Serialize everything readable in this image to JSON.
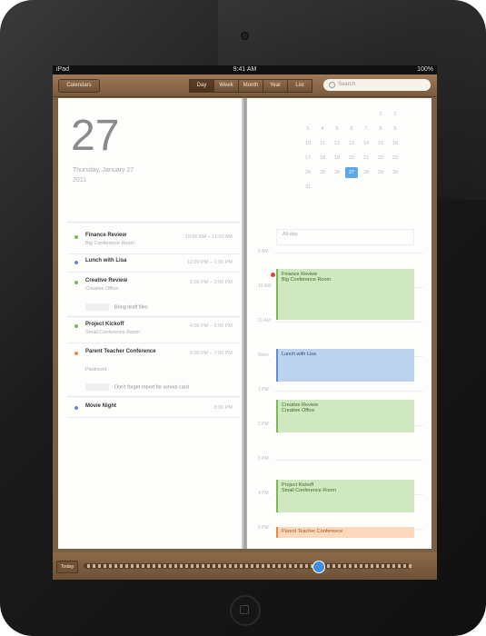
{
  "status": {
    "left": "iPad",
    "time": "9:41 AM",
    "right": "100%"
  },
  "nav": {
    "back_label": "Calendars",
    "segments": [
      {
        "label": "Day",
        "active": true
      },
      {
        "label": "Week",
        "active": false
      },
      {
        "label": "Month",
        "active": false
      },
      {
        "label": "Year",
        "active": false
      },
      {
        "label": "List",
        "active": false
      }
    ],
    "search_placeholder": "Search"
  },
  "day": {
    "number": "27",
    "full_date": "Thursday, January 27",
    "year": "2011"
  },
  "events": [
    {
      "title": "Finance Review",
      "sub": "Big Conference Room",
      "time": "10:00 AM – 11:00 AM",
      "color": "#7ab85a"
    },
    {
      "title": "Lunch with Lisa",
      "sub": "",
      "time": "12:00 PM – 1:00 PM",
      "color": "#5a8fd8"
    },
    {
      "title": "Creative Review",
      "sub": "Creative Office",
      "time": "2:00 PM – 3:00 PM",
      "color": "#7ab85a"
    },
    {
      "title": "Project Kickoff",
      "sub": "Small Conference Room",
      "time": "4:00 PM – 5:00 PM",
      "color": "#7ab85a"
    },
    {
      "title": "Parent Teacher Conference",
      "sub": "Piedmont",
      "time": "6:00 PM – 7:00 PM",
      "color": "#f08a3a"
    },
    {
      "title": "Movie Night",
      "sub": "",
      "time": "8:00 PM",
      "color": "#5a8fd8"
    }
  ],
  "notes": [
    {
      "text": "Bring draft files"
    },
    {
      "text": "Don't forget report for school card"
    }
  ],
  "timeline": {
    "hours": [
      "9 AM",
      "10 AM",
      "11 AM",
      "Noon",
      "1 PM",
      "2 PM",
      "3 PM",
      "4 PM",
      "5 PM"
    ],
    "allday": "All-day",
    "blocks": [
      {
        "title": "Finance Review",
        "sub": "Big Conference Room",
        "style": "green"
      },
      {
        "title": "Lunch with Lisa",
        "sub": "",
        "style": "blue"
      },
      {
        "title": "Creative Review",
        "sub": "Creative Office",
        "style": "green"
      },
      {
        "title": "Project Kickoff",
        "sub": "Small Conference Room",
        "style": "green"
      },
      {
        "title": "Parent Teacher Conference",
        "sub": "",
        "style": "orange"
      }
    ]
  },
  "mini_month": {
    "days": [
      "",
      "",
      "",
      "",
      "",
      "1",
      "2",
      "3",
      "4",
      "5",
      "6",
      "7",
      "8",
      "9",
      "10",
      "11",
      "12",
      "13",
      "14",
      "15",
      "16",
      "17",
      "18",
      "19",
      "20",
      "21",
      "22",
      "23",
      "24",
      "25",
      "26",
      "27",
      "28",
      "29",
      "30",
      "31"
    ],
    "today": "27"
  },
  "bottom": {
    "today_label": "Today"
  }
}
